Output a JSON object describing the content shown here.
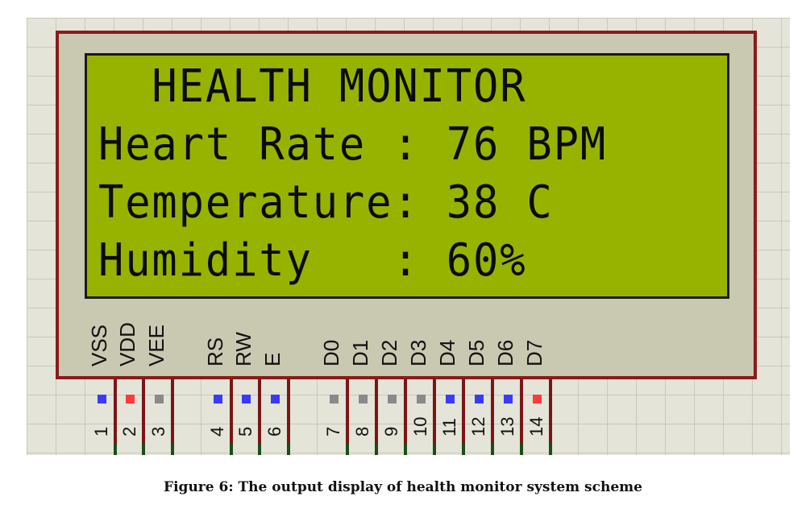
{
  "lcd": {
    "lines": [
      "  HEALTH MONITOR",
      "Heart Rate : 76 BPM",
      "Temperature: 38 C",
      "Humidity   : 60%"
    ]
  },
  "pins": [
    {
      "label": "VSS",
      "number": "1",
      "color": "#3a3aff"
    },
    {
      "label": "VDD",
      "number": "2",
      "color": "#ff3a3a"
    },
    {
      "label": "VEE",
      "number": "3",
      "color": "#8a8a8a"
    },
    {
      "label": "RS",
      "number": "4",
      "color": "#3a3aff"
    },
    {
      "label": "RW",
      "number": "5",
      "color": "#3a3aff"
    },
    {
      "label": "E",
      "number": "6",
      "color": "#3a3aff"
    },
    {
      "label": "D0",
      "number": "7",
      "color": "#8a8a8a"
    },
    {
      "label": "D1",
      "number": "8",
      "color": "#8a8a8a"
    },
    {
      "label": "D2",
      "number": "9",
      "color": "#8a8a8a"
    },
    {
      "label": "D3",
      "number": "10",
      "color": "#8a8a8a"
    },
    {
      "label": "D4",
      "number": "11",
      "color": "#3a3aff"
    },
    {
      "label": "D5",
      "number": "12",
      "color": "#3a3aff"
    },
    {
      "label": "D6",
      "number": "13",
      "color": "#3a3aff"
    },
    {
      "label": "D7",
      "number": "14",
      "color": "#ff3a3a"
    }
  ],
  "caption": "Figure 6: The output display of health monitor system scheme"
}
